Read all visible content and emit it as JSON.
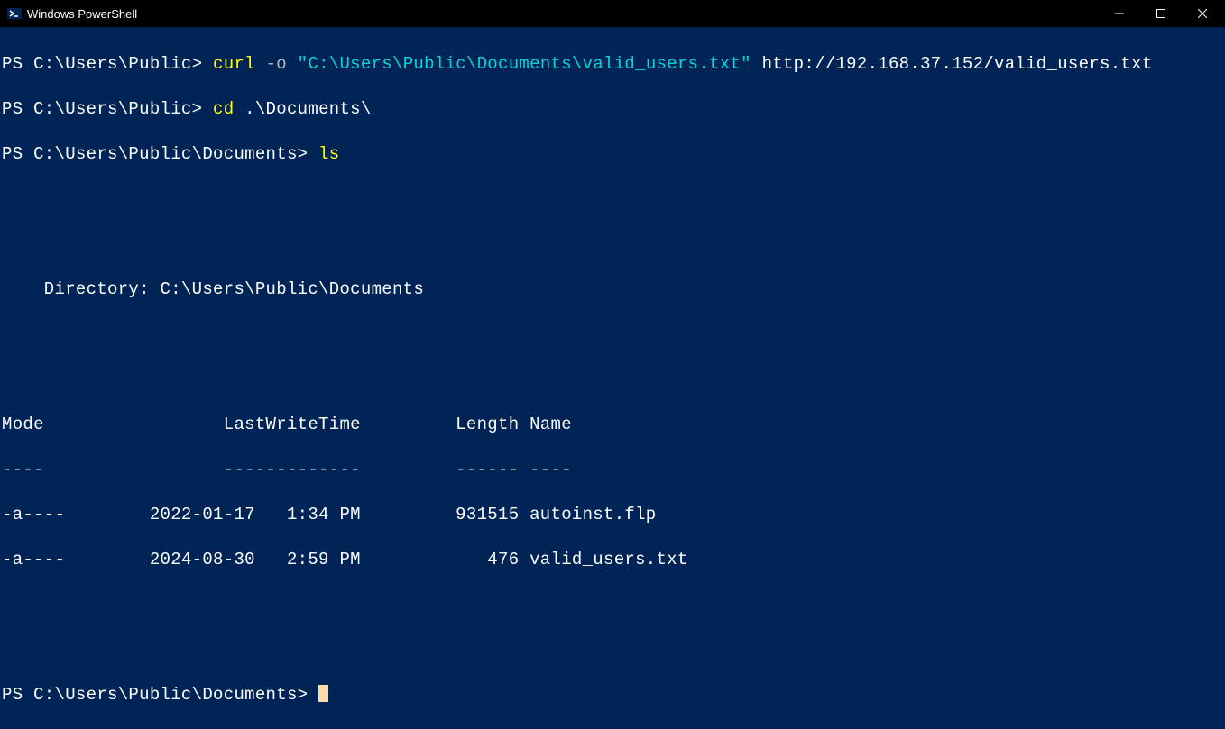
{
  "window": {
    "title": "Windows PowerShell"
  },
  "lines": {
    "l1_prompt": "PS C:\\Users\\Public> ",
    "l1_cmd": "curl ",
    "l1_flag": "-o ",
    "l1_path": "\"C:\\Users\\Public\\Documents\\valid_users.txt\" ",
    "l1_url": "http://192.168.37.152/valid_users.txt",
    "l2_prompt": "PS C:\\Users\\Public> ",
    "l2_cmd": "cd ",
    "l2_arg": ".\\Documents\\",
    "l3_prompt": "PS C:\\Users\\Public\\Documents> ",
    "l3_cmd": "ls",
    "dir_label": "    Directory: C:\\Users\\Public\\Documents",
    "hdr": "Mode                 LastWriteTime         Length Name",
    "hdr_sep": "----                 -------------         ------ ----",
    "row1": "-a----        2022-01-17   1:34 PM         931515 autoinst.flp",
    "row2": "-a----        2024-08-30   2:59 PM            476 valid_users.txt",
    "l4_prompt": "PS C:\\Users\\Public\\Documents> "
  }
}
